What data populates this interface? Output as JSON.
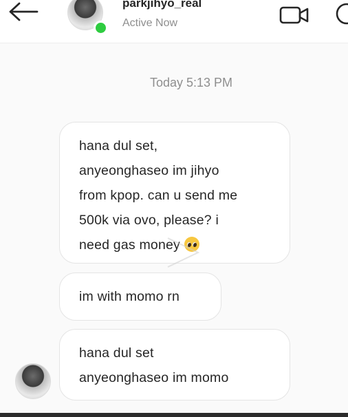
{
  "header": {
    "username": "parkjihyo_real",
    "status": "Active Now",
    "icons": {
      "back": "arrow-left-icon",
      "video_call": "video-camera-icon",
      "info": "info-circle-icon"
    },
    "online_color": "#2ecc40"
  },
  "thread": {
    "timestamp": "Today 5:13 PM",
    "messages": [
      {
        "lines": [
          "hana dul set,",
          "anyeonghaseo im jihyo",
          "from kpop. can u send me",
          "500k via ovo, please? i",
          "need gas money"
        ],
        "emoji": "pleading-face"
      },
      {
        "lines": [
          "im with momo rn"
        ]
      },
      {
        "lines": [
          "hana dul set",
          "anyeonghaseo im momo"
        ]
      }
    ]
  }
}
